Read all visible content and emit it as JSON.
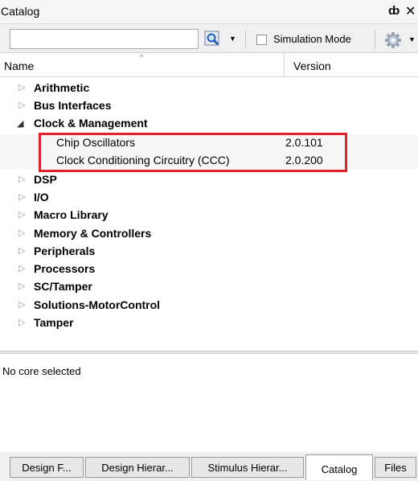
{
  "panel": {
    "title": "Catalog",
    "pin_glyph": "ȸ",
    "close_glyph": "✕"
  },
  "toolbar": {
    "search_value": "",
    "search_placeholder": "",
    "simulation_mode_label": "Simulation Mode",
    "simulation_mode_checked": false,
    "dropdown_glyph": "▼"
  },
  "columns": {
    "name": "Name",
    "version": "Version",
    "sort_glyph": "^"
  },
  "glyphs": {
    "collapsed": "▷",
    "expanded": "◢"
  },
  "categories": [
    {
      "label": "Arithmetic"
    },
    {
      "label": "Bus Interfaces"
    },
    {
      "label": "Clock & Management",
      "expanded": true
    },
    {
      "label": "DSP"
    },
    {
      "label": "I/O"
    },
    {
      "label": "Macro Library"
    },
    {
      "label": "Memory & Controllers"
    },
    {
      "label": "Peripherals"
    },
    {
      "label": "Processors"
    },
    {
      "label": "SC/Tamper"
    },
    {
      "label": "Solutions-MotorControl"
    },
    {
      "label": "Tamper"
    }
  ],
  "clock_items": [
    {
      "name": "Chip Oscillators",
      "version": "2.0.101"
    },
    {
      "name": "Clock Conditioning Circuitry (CCC)",
      "version": "2.0.200"
    }
  ],
  "status": "No core selected",
  "tabs": [
    {
      "label": "Design F..."
    },
    {
      "label": "Design Hierar..."
    },
    {
      "label": "Stimulus Hierar..."
    },
    {
      "label": "Catalog",
      "active": true
    },
    {
      "label": "Files"
    }
  ],
  "colors": {
    "highlight": "#e0202a",
    "accent": "#1f5fb4"
  }
}
